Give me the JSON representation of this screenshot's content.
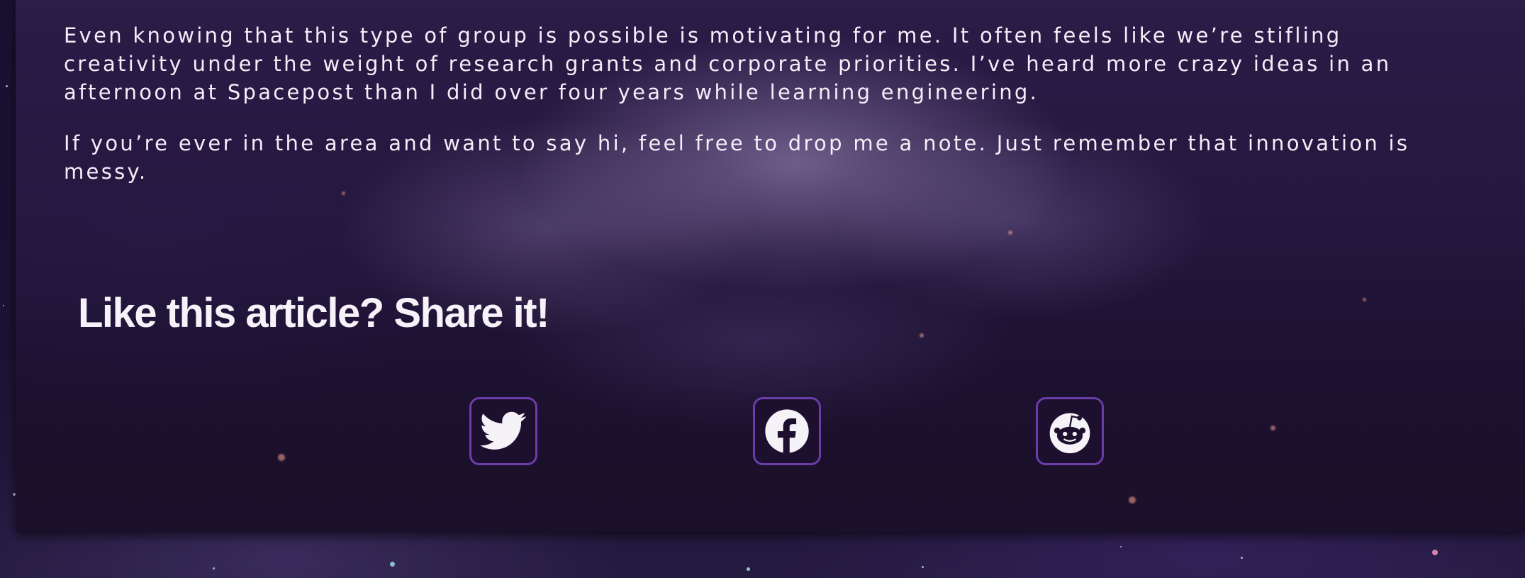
{
  "article": {
    "paragraphs": [
      "Even knowing that this type of group is possible is motivating for me. It often feels like we’re stifling creativity under the weight of research grants and corporate priorities. I’ve heard more crazy ideas in an afternoon at Spacepost than I did over four years while learning engineering.",
      "If you’re ever in the area and want to say hi, feel free to drop me a note. Just remember that innovation is messy."
    ]
  },
  "share": {
    "heading": "Like this article? Share it!",
    "buttons": [
      {
        "name": "twitter",
        "icon": "twitter-bird-icon"
      },
      {
        "name": "facebook",
        "icon": "facebook-icon"
      },
      {
        "name": "reddit",
        "icon": "reddit-alien-icon"
      }
    ]
  },
  "colors": {
    "text": "#f3eef8",
    "button_border": "#6a3ea8",
    "button_bg": "#1d0f2e",
    "icon": "#f5f2f8"
  }
}
